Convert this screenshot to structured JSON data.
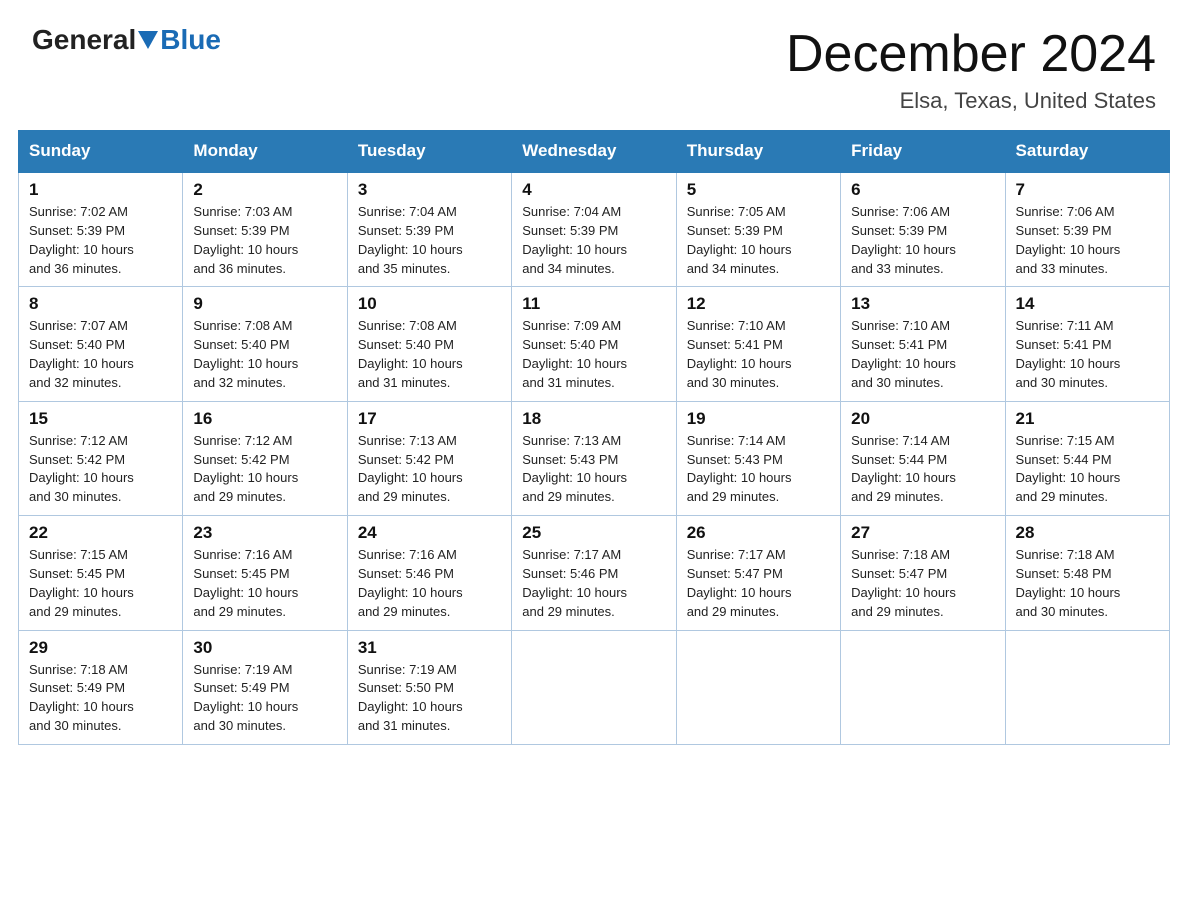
{
  "header": {
    "logo_general": "General",
    "logo_blue": "Blue",
    "month_title": "December 2024",
    "location": "Elsa, Texas, United States"
  },
  "weekdays": [
    "Sunday",
    "Monday",
    "Tuesday",
    "Wednesday",
    "Thursday",
    "Friday",
    "Saturday"
  ],
  "weeks": [
    [
      {
        "day": "1",
        "sunrise": "7:02 AM",
        "sunset": "5:39 PM",
        "daylight": "10 hours and 36 minutes."
      },
      {
        "day": "2",
        "sunrise": "7:03 AM",
        "sunset": "5:39 PM",
        "daylight": "10 hours and 36 minutes."
      },
      {
        "day": "3",
        "sunrise": "7:04 AM",
        "sunset": "5:39 PM",
        "daylight": "10 hours and 35 minutes."
      },
      {
        "day": "4",
        "sunrise": "7:04 AM",
        "sunset": "5:39 PM",
        "daylight": "10 hours and 34 minutes."
      },
      {
        "day": "5",
        "sunrise": "7:05 AM",
        "sunset": "5:39 PM",
        "daylight": "10 hours and 34 minutes."
      },
      {
        "day": "6",
        "sunrise": "7:06 AM",
        "sunset": "5:39 PM",
        "daylight": "10 hours and 33 minutes."
      },
      {
        "day": "7",
        "sunrise": "7:06 AM",
        "sunset": "5:39 PM",
        "daylight": "10 hours and 33 minutes."
      }
    ],
    [
      {
        "day": "8",
        "sunrise": "7:07 AM",
        "sunset": "5:40 PM",
        "daylight": "10 hours and 32 minutes."
      },
      {
        "day": "9",
        "sunrise": "7:08 AM",
        "sunset": "5:40 PM",
        "daylight": "10 hours and 32 minutes."
      },
      {
        "day": "10",
        "sunrise": "7:08 AM",
        "sunset": "5:40 PM",
        "daylight": "10 hours and 31 minutes."
      },
      {
        "day": "11",
        "sunrise": "7:09 AM",
        "sunset": "5:40 PM",
        "daylight": "10 hours and 31 minutes."
      },
      {
        "day": "12",
        "sunrise": "7:10 AM",
        "sunset": "5:41 PM",
        "daylight": "10 hours and 30 minutes."
      },
      {
        "day": "13",
        "sunrise": "7:10 AM",
        "sunset": "5:41 PM",
        "daylight": "10 hours and 30 minutes."
      },
      {
        "day": "14",
        "sunrise": "7:11 AM",
        "sunset": "5:41 PM",
        "daylight": "10 hours and 30 minutes."
      }
    ],
    [
      {
        "day": "15",
        "sunrise": "7:12 AM",
        "sunset": "5:42 PM",
        "daylight": "10 hours and 30 minutes."
      },
      {
        "day": "16",
        "sunrise": "7:12 AM",
        "sunset": "5:42 PM",
        "daylight": "10 hours and 29 minutes."
      },
      {
        "day": "17",
        "sunrise": "7:13 AM",
        "sunset": "5:42 PM",
        "daylight": "10 hours and 29 minutes."
      },
      {
        "day": "18",
        "sunrise": "7:13 AM",
        "sunset": "5:43 PM",
        "daylight": "10 hours and 29 minutes."
      },
      {
        "day": "19",
        "sunrise": "7:14 AM",
        "sunset": "5:43 PM",
        "daylight": "10 hours and 29 minutes."
      },
      {
        "day": "20",
        "sunrise": "7:14 AM",
        "sunset": "5:44 PM",
        "daylight": "10 hours and 29 minutes."
      },
      {
        "day": "21",
        "sunrise": "7:15 AM",
        "sunset": "5:44 PM",
        "daylight": "10 hours and 29 minutes."
      }
    ],
    [
      {
        "day": "22",
        "sunrise": "7:15 AM",
        "sunset": "5:45 PM",
        "daylight": "10 hours and 29 minutes."
      },
      {
        "day": "23",
        "sunrise": "7:16 AM",
        "sunset": "5:45 PM",
        "daylight": "10 hours and 29 minutes."
      },
      {
        "day": "24",
        "sunrise": "7:16 AM",
        "sunset": "5:46 PM",
        "daylight": "10 hours and 29 minutes."
      },
      {
        "day": "25",
        "sunrise": "7:17 AM",
        "sunset": "5:46 PM",
        "daylight": "10 hours and 29 minutes."
      },
      {
        "day": "26",
        "sunrise": "7:17 AM",
        "sunset": "5:47 PM",
        "daylight": "10 hours and 29 minutes."
      },
      {
        "day": "27",
        "sunrise": "7:18 AM",
        "sunset": "5:47 PM",
        "daylight": "10 hours and 29 minutes."
      },
      {
        "day": "28",
        "sunrise": "7:18 AM",
        "sunset": "5:48 PM",
        "daylight": "10 hours and 30 minutes."
      }
    ],
    [
      {
        "day": "29",
        "sunrise": "7:18 AM",
        "sunset": "5:49 PM",
        "daylight": "10 hours and 30 minutes."
      },
      {
        "day": "30",
        "sunrise": "7:19 AM",
        "sunset": "5:49 PM",
        "daylight": "10 hours and 30 minutes."
      },
      {
        "day": "31",
        "sunrise": "7:19 AM",
        "sunset": "5:50 PM",
        "daylight": "10 hours and 31 minutes."
      },
      null,
      null,
      null,
      null
    ]
  ],
  "labels": {
    "sunrise": "Sunrise:",
    "sunset": "Sunset:",
    "daylight": "Daylight:"
  }
}
